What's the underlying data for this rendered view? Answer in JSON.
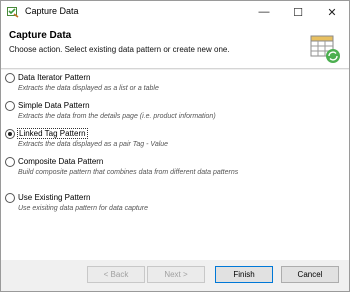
{
  "window": {
    "title": "Capture Data",
    "controls": {
      "minimize": "—",
      "maximize": "☐",
      "close": "✕"
    }
  },
  "header": {
    "title": "Capture Data",
    "description": "Choose action. Select existing data pattern or create new one."
  },
  "options": [
    {
      "label": "Data Iterator Pattern",
      "description": "Extracts the data displayed as a list or a table",
      "selected": false
    },
    {
      "label": "Simple Data Pattern",
      "description": "Extracts the data from the details page (i.e. product information)",
      "selected": false
    },
    {
      "label": "Linked Tag Pattern",
      "description": "Extracts the data displayed as a pair Tag - Value",
      "selected": true
    },
    {
      "label": "Composite Data Pattern",
      "description": "Build composite pattern that combines data from different data patterns",
      "selected": false
    },
    {
      "label": "Use Existing Pattern",
      "description": "Use exisiting data pattern for data capture",
      "selected": false
    }
  ],
  "buttons": {
    "back": "< Back",
    "next": "Next >",
    "finish": "Finish",
    "cancel": "Cancel"
  },
  "colors": {
    "accent": "#0078d7",
    "icon_green": "#4caf50",
    "icon_orange": "#f0a030"
  }
}
